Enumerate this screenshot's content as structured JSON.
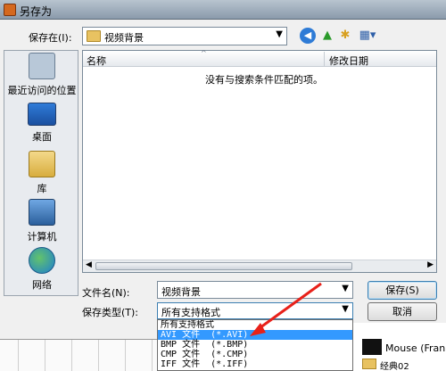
{
  "window": {
    "title": "另存为"
  },
  "toolbar": {
    "save_in_label": "保存在(I):",
    "location": "视频背景",
    "icons": [
      "back-icon",
      "up-folder-icon",
      "new-folder-icon",
      "views-menu-icon"
    ]
  },
  "sidebar": {
    "items": [
      {
        "label": "最近访问的位置",
        "icon": "recent-places-icon"
      },
      {
        "label": "桌面",
        "icon": "desktop-icon"
      },
      {
        "label": "库",
        "icon": "library-icon"
      },
      {
        "label": "计算机",
        "icon": "computer-icon"
      },
      {
        "label": "网络",
        "icon": "network-icon"
      }
    ]
  },
  "file_list": {
    "columns": [
      "名称",
      "修改日期"
    ],
    "empty_message": "没有与搜索条件匹配的项。"
  },
  "form": {
    "file_name_label": "文件名(N):",
    "file_name_value": "视频背景",
    "file_type_label": "保存类型(T):",
    "file_type_value": "所有支持格式"
  },
  "buttons": {
    "save": "保存(S)",
    "cancel": "取消"
  },
  "dropdown": {
    "options": [
      "所有支持格式",
      "AVI 文件  (*.AVI)",
      "BMP 文件  (*.BMP)",
      "CMP 文件  (*.CMP)",
      "IFF 文件  (*.IFF)"
    ],
    "selected_index": 1
  },
  "background": {
    "item_label": "Mouse (Fran",
    "folder_label": "经典02"
  },
  "colors": {
    "accent": "#3399ff",
    "annotation_arrow": "#e8211a"
  }
}
